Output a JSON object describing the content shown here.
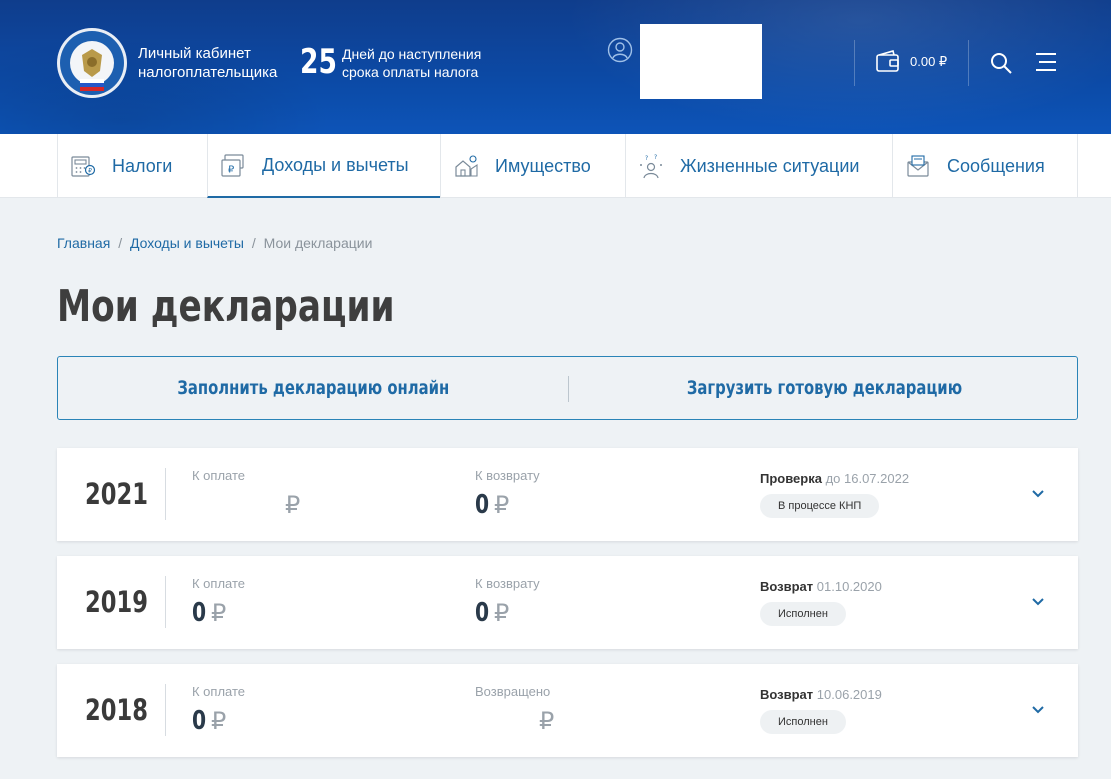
{
  "header": {
    "cabinet_title_line1": "Личный кабинет",
    "cabinet_title_line2": "налогоплательщика",
    "days_count": "25",
    "days_text_line1": "Дней до наступления",
    "days_text_line2": "срока оплаты налога",
    "balance": "0.00 ₽",
    "colors": {
      "header_bg": "#0c4aa6",
      "accent": "#1f6aa5"
    }
  },
  "nav": {
    "items": [
      {
        "label": "Налоги",
        "icon": "calculator-icon",
        "active": false
      },
      {
        "label": "Доходы и вычеты",
        "icon": "ruble-documents-icon",
        "active": true
      },
      {
        "label": "Имущество",
        "icon": "property-icon",
        "active": false
      },
      {
        "label": "Жизненные ситуации",
        "icon": "person-ideas-icon",
        "active": false
      },
      {
        "label": "Сообщения",
        "icon": "envelope-icon",
        "active": false
      }
    ]
  },
  "breadcrumb": {
    "items": [
      "Главная",
      "Доходы и вычеты",
      "Мои декларации"
    ],
    "separator": "/"
  },
  "page": {
    "title": "Мои декларации"
  },
  "actions": {
    "fill_online": "Заполнить декларацию онлайн",
    "upload_ready": "Загрузить готовую декларацию"
  },
  "declarations": [
    {
      "year": "2021",
      "left_label": "К оплате",
      "left_amount": "",
      "right_label": "К возврату",
      "right_amount": "0",
      "currency": "₽",
      "status_title": "Проверка",
      "status_date": "до 16.07.2022",
      "badge": "В процессе КНП"
    },
    {
      "year": "2019",
      "left_label": "К оплате",
      "left_amount": "0",
      "right_label": "К возврату",
      "right_amount": "0",
      "currency": "₽",
      "status_title": "Возврат",
      "status_date": "01.10.2020",
      "badge": "Исполнен"
    },
    {
      "year": "2018",
      "left_label": "К оплате",
      "left_amount": "0",
      "right_label": "Возвращено",
      "right_amount": "",
      "currency": "₽",
      "status_title": "Возврат",
      "status_date": "10.06.2019",
      "badge": "Исполнен"
    }
  ]
}
